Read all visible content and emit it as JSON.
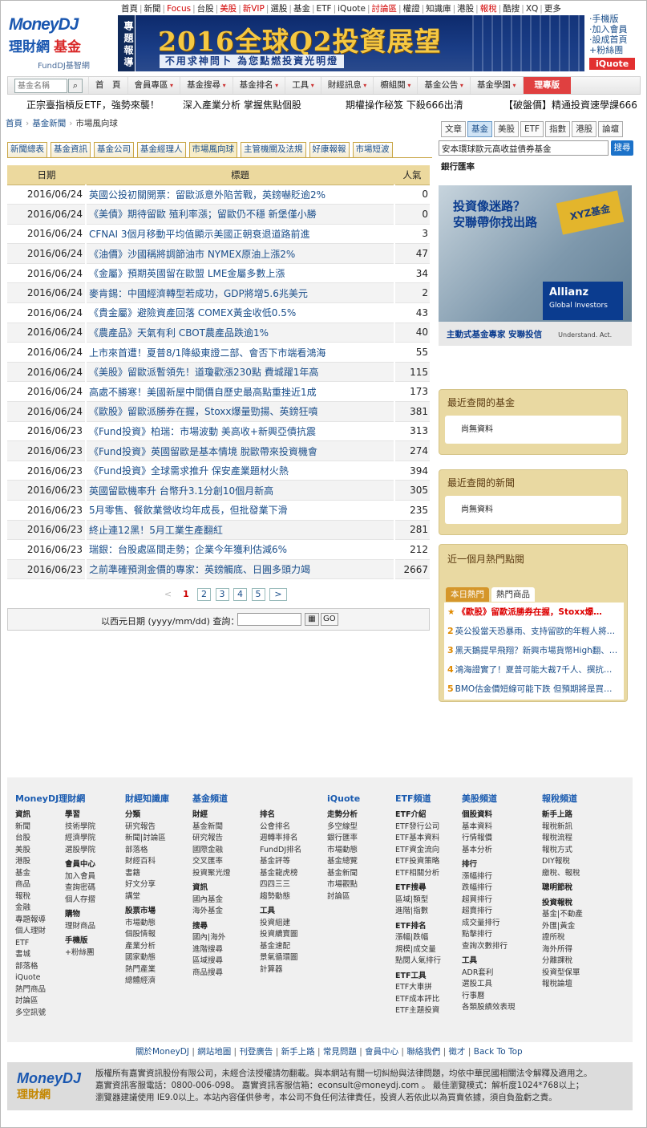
{
  "header": {
    "logo_brand": "MoneyDJ",
    "logo_name": "理財網",
    "logo_sub": "基金",
    "logo_tag": "FundDJ基智網",
    "topnav": [
      "首頁",
      "新聞",
      "Focus",
      "台股",
      "美股",
      "新VIP",
      "選股",
      "基金",
      "ETF",
      "iQuote",
      "討論區",
      "權證",
      "知識庫",
      "港股",
      "報稅",
      "酷搜",
      "XQ",
      "更多"
    ],
    "banner_tag": "專題報導",
    "banner_title": "2016全球Q2投資展望",
    "banner_sub": "不用求神問卜 為您點燃投資光明燈",
    "side_links": [
      "‧手機版",
      "‧加入會員",
      "‧設成首頁",
      "+粉絲團"
    ],
    "iquote": "iQuote"
  },
  "menubar": {
    "search_placeholder": "基金名稱",
    "items": [
      "首　頁",
      "會員專區",
      "基金搜尋",
      "基金排名",
      "工具",
      "財經訊息",
      "櫥組閱",
      "基金公告",
      "基金學園"
    ],
    "highlight": "理專版"
  },
  "ticker": [
    "正宗臺指槓反ETF，強勢來襲！",
    "深入產業分析 掌握焦點個股",
    "期權操作秘笈 下殺666出清",
    "【破盤價】精通投資速學課666"
  ],
  "breadcrumb": [
    "首頁",
    "基金新聞",
    "市場風向球"
  ],
  "tabs": [
    "新聞總表",
    "基金資訊",
    "基金公司",
    "基金經理人",
    "市場風向球",
    "主管機關及法規",
    "好康報報",
    "市場短波"
  ],
  "active_tab": "市場風向球",
  "table": {
    "headers": [
      "日期",
      "標題",
      "人氣"
    ],
    "rows": [
      [
        "2016/06/24",
        "英國公投初關開票：留歐派意外陷苦戰，英鎊嚇貶逾2%",
        "0"
      ],
      [
        "2016/06/24",
        "《美債》期待留歐 殖利率漲；留歐仍不穩 新堡僅小勝",
        "0"
      ],
      [
        "2016/06/24",
        "CFNAI 3個月移動平均值顯示美國正朝衰退道路前進",
        "3"
      ],
      [
        "2016/06/24",
        "《油價》沙國稱將調節油市 NYMEX原油上漲2%",
        "47"
      ],
      [
        "2016/06/24",
        "《金屬》預期英國留在歐盟 LME金屬多數上漲",
        "34"
      ],
      [
        "2016/06/24",
        "麥肯錫：中國經濟轉型若成功，GDP將增5.6兆美元",
        "2"
      ],
      [
        "2016/06/24",
        "《貴金屬》避險資產回落 COMEX黃金收低0.5%",
        "43"
      ],
      [
        "2016/06/24",
        "《農產品》天氣有利 CBOT農產品跌逾1%",
        "40"
      ],
      [
        "2016/06/24",
        "上市來首遭！夏普8/1降級東證二部、會否下市端看鴻海",
        "55"
      ],
      [
        "2016/06/24",
        "《美股》留歐派暫領先！道瓊歡漲230點 費城躍1年高",
        "115"
      ],
      [
        "2016/06/24",
        "高處不勝寒！美國新屋中間價自歷史最高點重挫近1成",
        "173"
      ],
      [
        "2016/06/24",
        "《歐股》留歐派勝券在握，Stoxx爆量勁揚、英鎊狂噴",
        "381"
      ],
      [
        "2016/06/23",
        "《Fund投資》柏瑞：市場波動 美高收+新興亞債抗震",
        "313"
      ],
      [
        "2016/06/23",
        "《Fund投資》英國留歐是基本情境 脫歐帶來投資機會",
        "274"
      ],
      [
        "2016/06/23",
        "《Fund投資》全球需求推升 保安產業題材火熱",
        "394"
      ],
      [
        "2016/06/23",
        "英國留歐機率升 台幣升3.1分創10個月新高",
        "305"
      ],
      [
        "2016/06/23",
        "5月零售、餐飲業營收均年成長，但批發業下滑",
        "235"
      ],
      [
        "2016/06/23",
        "終止連12黑！5月工業生產翻紅",
        "281"
      ],
      [
        "2016/06/23",
        "瑞銀：台股處區間走勢；企業今年獲利估減6%",
        "212"
      ],
      [
        "2016/06/23",
        "之前準確預測金價的專家：英鎊觸底、日圓多頭力竭",
        "2667"
      ]
    ]
  },
  "pager": {
    "prev": "<",
    "current": "1",
    "pages": [
      "2",
      "3",
      "4",
      "5"
    ],
    "next": ">"
  },
  "date_query": {
    "label": "以西元日期 (yyyy/mm/dd) 查詢：",
    "go": "GO"
  },
  "right": {
    "tabs": [
      "文章",
      "基金",
      "美股",
      "ETF",
      "指數",
      "港股",
      "論壇"
    ],
    "active_tab": "基金",
    "search_value": "安本環球歐元高收益債券基金",
    "search_btn": "搜尋",
    "suggest": "銀行匯率",
    "ad": {
      "q1": "投資像迷路？",
      "q2": "安聯帶你找出路",
      "sign": "XYZ基金",
      "brand": "Allianz",
      "brand_sub": "Global Investors",
      "foot": "主動式基金專家 安聯投信",
      "foot_sub": "Understand. Act."
    },
    "recent_funds": {
      "title": "最近查閱的基金",
      "empty": "尚無資料"
    },
    "recent_news": {
      "title": "最近查閱的新聞",
      "empty": "尚無資料"
    },
    "hot": {
      "title": "近一個月熱門點閱",
      "tabs": [
        "本日熱門",
        "熱門商品"
      ],
      "items": [
        "《歐股》留歐派勝券在握，Stoxx爆…",
        "英公投當天恐暴雨、支持留歐的年輕人將…",
        "黑天鵝提早飛翔？新興市場貨幣High翻、…",
        "鴻海證實了！夏普可能大裁7千人、撰抗…",
        "BMO估金價短線可能下跌 但預期將是買…"
      ]
    }
  },
  "footer": {
    "columns": [
      {
        "title": "MoneyDJ理財網",
        "groups": [
          [
            "資訊",
            "新聞",
            "台股",
            "美股",
            "港股",
            "基金",
            "商品",
            "報稅",
            "金融",
            "專題報導",
            "個人理財",
            "ETF",
            "書城",
            "部落格",
            "iQuote",
            "熱門商品",
            "討論區",
            "多空訊號"
          ],
          [
            "學習",
            "技術學院",
            "經濟學院",
            "選股學院",
            "",
            "會員中心",
            "加入會員",
            "查詢密碼",
            "個人存摺",
            "",
            "購物",
            "理財商品",
            "",
            "手機版",
            "+粉絲團"
          ]
        ]
      },
      {
        "title": "財經知識庫",
        "groups": [
          [
            "分類",
            "研究報告",
            "新聞|討論區",
            "部落格",
            "財經百科",
            "書籍",
            "好文分享",
            "講堂",
            "",
            "股票市場",
            "市場動態",
            "個股情報",
            "產業分析",
            "國家動態",
            "熱門產業",
            "總體經濟"
          ]
        ]
      },
      {
        "title": "基金頻道",
        "groups": [
          [
            "財經",
            "基金新聞",
            "研究報告",
            "國際金融",
            "交叉匯率",
            "投資聚光燈",
            "",
            "資訊",
            "國內基金",
            "海外基金",
            "",
            "搜尋",
            "國內|海外",
            "進階搜尋",
            "區域搜尋",
            "商品搜尋"
          ]
        ]
      },
      {
        "title": "",
        "groups": [
          [
            "排名",
            "公會排名",
            "週轉率排名",
            "FundDJ排名",
            "基金評等",
            "基金龍虎榜",
            "四四三三",
            "趨勢動態",
            "",
            "工具",
            "投資組建",
            "投資續寶圖",
            "基金速配",
            "景氣循環圖",
            "計算器"
          ]
        ]
      },
      {
        "title": "iQuote",
        "groups": [
          [
            "走勢分析",
            "多空線型",
            "銀行匯率",
            "市場動態",
            "基金總覽",
            "基金新聞",
            "市場觀點",
            "討論區"
          ]
        ]
      },
      {
        "title": "ETF頻道",
        "groups": [
          [
            "ETF介紹",
            "ETF發行公司",
            "ETF基本資料",
            "ETF資金流向",
            "ETF投資策略",
            "ETF相關分析",
            "",
            "ETF搜尋",
            "區域|類型",
            "進階|指數",
            "",
            "ETF排名",
            "漲幅|跌幅",
            "規模|成交量",
            "點閱人氣排行",
            "",
            "ETF工具",
            "ETF大車拼",
            "ETF成本評比",
            "ETF主題投資"
          ]
        ]
      },
      {
        "title": "美股頻道",
        "groups": [
          [
            "個股資料",
            "基本資料",
            "行情報價",
            "基本分析",
            "",
            "排行",
            "漲幅排行",
            "跌幅排行",
            "超買排行",
            "超賣排行",
            "成交量排行",
            "點擊排行",
            "查詢次數排行",
            "",
            "工具",
            "ADR套利",
            "選股工具",
            "行事曆",
            "各類股績效表現"
          ]
        ]
      },
      {
        "title": "報稅頻道",
        "groups": [
          [
            "新手上路",
            "報稅新訊",
            "報稅流程",
            "報稅方式",
            "DIY報稅",
            "繳稅、報稅",
            "",
            "聰明節稅",
            "",
            "投資報稅",
            "基金|不動產",
            "外匯|黃金",
            "證所稅",
            "海外所得",
            "分離課稅",
            "投資型保單",
            "報稅論壇"
          ]
        ]
      }
    ],
    "links": [
      "關於MoneyDJ",
      "網站地圖",
      "刊登廣告",
      "新手上路",
      "常見問題",
      "會員中心",
      "聯絡我們",
      "徵才",
      "Back To Top"
    ],
    "copyright": [
      "版權所有嘉實資訊股份有限公司，未經合法授權請勿翻載。與本網站有關一切糾紛與法律問題，均依中華民國相關法令解釋及適用之。",
      "嘉實資訊客服電話：0800-006-098。 嘉實資訊客服信箱：econsult@moneydj.com 。 最佳瀏覽模式：解析度1024*768以上；",
      "瀏覽器建議使用 IE9.0以上。本站內容僅供參考，本公司不負任何法律責任，投資人若依此以為買賣依據，須自負盈虧之責。"
    ]
  }
}
